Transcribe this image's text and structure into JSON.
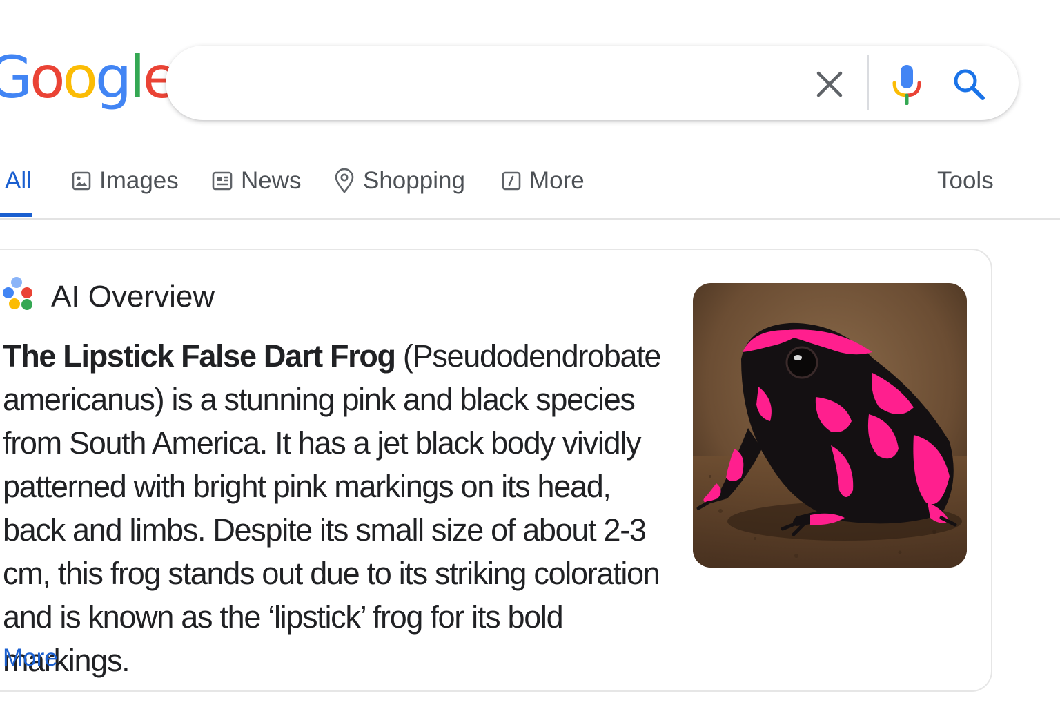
{
  "header": {
    "logo_letters": [
      {
        "ch": "G",
        "color": "#4285F4"
      },
      {
        "ch": "o",
        "color": "#EA4335"
      },
      {
        "ch": "o",
        "color": "#FBBC05"
      },
      {
        "ch": "g",
        "color": "#4285F4"
      },
      {
        "ch": "l",
        "color": "#34A853"
      },
      {
        "ch": "e",
        "color": "#EA4335"
      }
    ],
    "search": {
      "value": "",
      "placeholder": ""
    },
    "icons": {
      "clear": "close-icon",
      "mic": "microphone-icon",
      "search": "search-icon"
    }
  },
  "tabs": [
    {
      "label": "All",
      "icon": null,
      "active": true
    },
    {
      "label": "Images",
      "icon": "image-icon"
    },
    {
      "label": "News",
      "icon": "news-icon"
    },
    {
      "label": "Shopping",
      "icon": "location-pin-icon"
    },
    {
      "label": "More",
      "icon": "edit-square-icon"
    }
  ],
  "tools_label": "Tools",
  "ai_overview": {
    "title": "AI Overview",
    "bold_lead": "The Lipstick False Dart Frog",
    "body": " (Pseudodendrobate americanus) is a stunning pink and black species from South America. It has a jet black body vividly patterned with bright pink markings on its head, back and limbs. Despite its small size of about 2-3 cm, this frog stands out due to its striking coloration and is known as the ‘lipstick’ frog for its bold markings.",
    "more_label": "More",
    "image_subject": "pink and black frog photo"
  },
  "colors": {
    "accent_blue": "#1a5fd0",
    "frog_pink": "#ff1f8e",
    "text": "#202124"
  }
}
